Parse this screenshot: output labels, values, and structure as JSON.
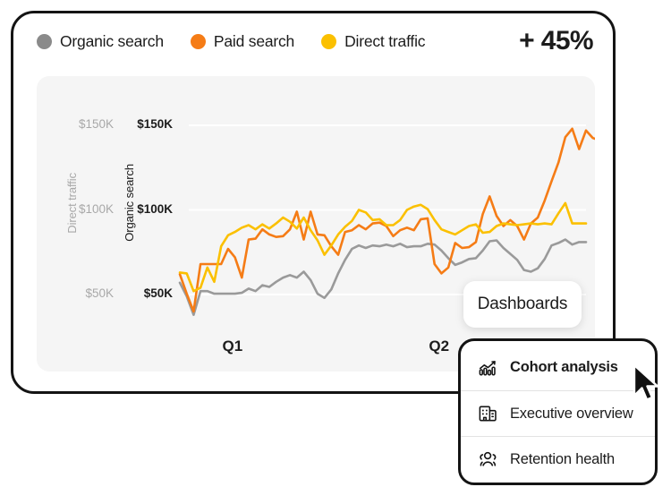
{
  "card": {
    "growth_badge": "+ 45%"
  },
  "legend": {
    "items": [
      {
        "label": "Organic search",
        "color": "#8a8a8a",
        "icon": "circle-icon"
      },
      {
        "label": "Paid search",
        "color": "#f57c16",
        "icon": "circle-icon"
      },
      {
        "label": "Direct traffic",
        "color": "#fbc000",
        "icon": "circle-icon"
      }
    ]
  },
  "overlay": {
    "pill_label": "Dashboards",
    "menu_items": [
      {
        "label": "Cohort analysis",
        "icon": "bar-chart-trend-icon",
        "active": true
      },
      {
        "label": "Executive overview",
        "icon": "office-building-icon",
        "active": false
      },
      {
        "label": "Retention health",
        "icon": "people-group-icon",
        "active": false
      }
    ],
    "cursor_icon": "mouse-pointer-icon"
  },
  "chart_data": {
    "type": "line",
    "title": "",
    "xlabel": "",
    "ylabel_left": "Direct traffic",
    "ylabel_right": "Organic search",
    "grid": true,
    "legend_position": "top-left",
    "ylim": [
      35000,
      170000
    ],
    "yticks": [
      50000,
      100000,
      150000
    ],
    "ytick_labels_left": [
      "$50K",
      "$100K",
      "$150K"
    ],
    "ytick_labels_right": [
      "$50K",
      "$100K",
      "$150K"
    ],
    "xticks": [
      8,
      38
    ],
    "xtick_labels": [
      "Q1",
      "Q2"
    ],
    "x": [
      0,
      1,
      2,
      3,
      4,
      5,
      6,
      7,
      8,
      9,
      10,
      11,
      12,
      13,
      14,
      15,
      16,
      17,
      18,
      19,
      20,
      21,
      22,
      23,
      24,
      25,
      26,
      27,
      28,
      29,
      30,
      31,
      32,
      33,
      34,
      35,
      36,
      37,
      38,
      39,
      40,
      41,
      42,
      43,
      44,
      45,
      46,
      47,
      48,
      49,
      50,
      51,
      52,
      53,
      54,
      55,
      56,
      57,
      58,
      59
    ],
    "series": [
      {
        "name": "Organic search",
        "color": "#9a9a9a",
        "values": [
          57000,
          49000,
          38000,
          52000,
          52000,
          50500,
          50500,
          50500,
          50500,
          51000,
          53500,
          52000,
          55500,
          54500,
          57500,
          60000,
          61500,
          60000,
          63500,
          58500,
          50500,
          48000,
          53000,
          62500,
          70500,
          77000,
          79000,
          77500,
          79000,
          78500,
          79500,
          78500,
          80000,
          78000,
          78500,
          78500,
          80000,
          79500,
          76000,
          71500,
          67500,
          69000,
          71000,
          71500,
          76000,
          81500,
          82000,
          77500,
          74000,
          70500,
          64500,
          63500,
          65500,
          71000,
          79000,
          80500,
          82500,
          79500,
          81000,
          81000
        ]
      },
      {
        "name": "Paid search",
        "color": "#f57c16",
        "values": [
          62000,
          50500,
          40000,
          68000,
          68000,
          68000,
          68000,
          77000,
          72000,
          60000,
          82500,
          83000,
          88500,
          85500,
          84000,
          84500,
          88500,
          99000,
          82500,
          99000,
          85500,
          85000,
          78500,
          73500,
          87000,
          88000,
          91000,
          88500,
          92000,
          92500,
          90500,
          84500,
          88000,
          89500,
          88000,
          94500,
          95000,
          68000,
          62500,
          66000,
          80500,
          77500,
          78000,
          81000,
          97500,
          108000,
          96500,
          90500,
          94000,
          90500,
          82500,
          92000,
          95500,
          105500,
          117000,
          128000,
          143000,
          148000,
          136000,
          147000,
          142500,
          141000
        ]
      },
      {
        "name": "Direct traffic",
        "color": "#fbc000",
        "values": [
          63000,
          62500,
          52000,
          54000,
          66000,
          57500,
          78500,
          85000,
          87000,
          89500,
          91000,
          88500,
          91500,
          89000,
          92000,
          95500,
          93000,
          89000,
          95500,
          88000,
          82000,
          73500,
          79000,
          85500,
          90000,
          93500,
          100000,
          98500,
          94000,
          94500,
          91000,
          91000,
          94000,
          100000,
          102000,
          103000,
          100500,
          94000,
          88500,
          87000,
          85500,
          88000,
          90500,
          91500,
          86500,
          87000,
          90500,
          92000,
          91500,
          91000,
          91500,
          92000,
          91500,
          92000,
          91500,
          98000,
          104000,
          92000,
          92000,
          92000
        ]
      }
    ]
  }
}
